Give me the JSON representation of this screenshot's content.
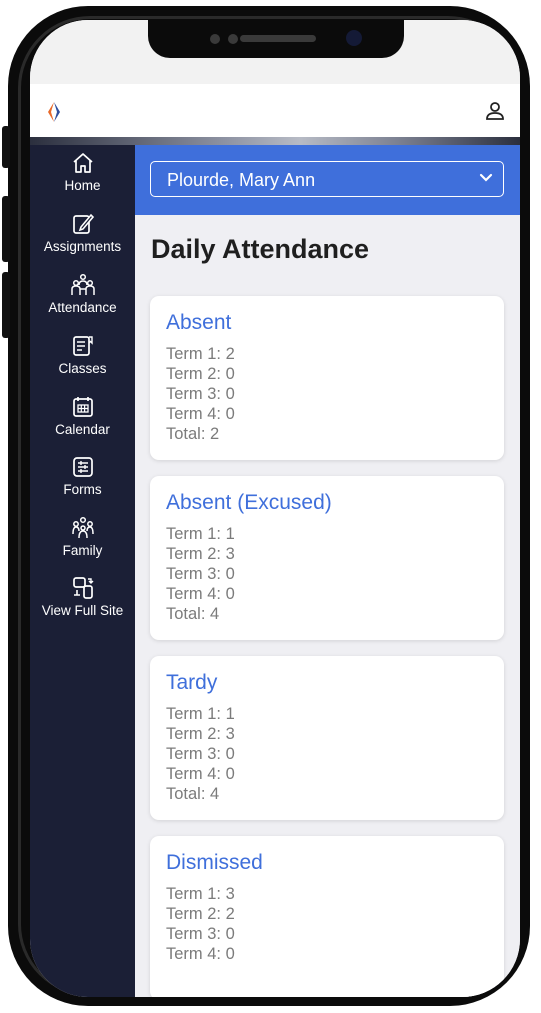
{
  "header": {
    "logo": "brand-logo",
    "user_icon": "user-icon"
  },
  "sidebar": {
    "items": [
      {
        "label": "Home",
        "icon": "home-icon"
      },
      {
        "label": "Assignments",
        "icon": "pencil-paper-icon"
      },
      {
        "label": "Attendance",
        "icon": "people-icon"
      },
      {
        "label": "Classes",
        "icon": "document-icon"
      },
      {
        "label": "Calendar",
        "icon": "calendar-icon"
      },
      {
        "label": "Forms",
        "icon": "form-icon"
      },
      {
        "label": "Family",
        "icon": "family-icon"
      },
      {
        "label": "View Full Site",
        "icon": "devices-icon"
      }
    ]
  },
  "student_select": {
    "value": "Plourde, Mary Ann"
  },
  "page": {
    "title": "Daily Attendance"
  },
  "cards": [
    {
      "title": "Absent",
      "lines": [
        "Term 1: 2",
        "Term 2: 0",
        "Term 3: 0",
        "Term 4: 0",
        "Total: 2"
      ]
    },
    {
      "title": "Absent (Excused)",
      "lines": [
        "Term 1: 1",
        "Term 2: 3",
        "Term 3: 0",
        "Term 4: 0",
        "Total: 4"
      ]
    },
    {
      "title": "Tardy",
      "lines": [
        "Term 1: 1",
        "Term 2: 3",
        "Term 3: 0",
        "Term 4: 0",
        "Total: 4"
      ]
    },
    {
      "title": "Dismissed",
      "lines": [
        "Term 1: 3",
        "Term 2: 2",
        "Term 3: 0",
        "Term 4: 0"
      ]
    }
  ],
  "colors": {
    "accent": "#3f6fdb",
    "sidebar": "#1b1f36",
    "background": "#efeff3"
  }
}
